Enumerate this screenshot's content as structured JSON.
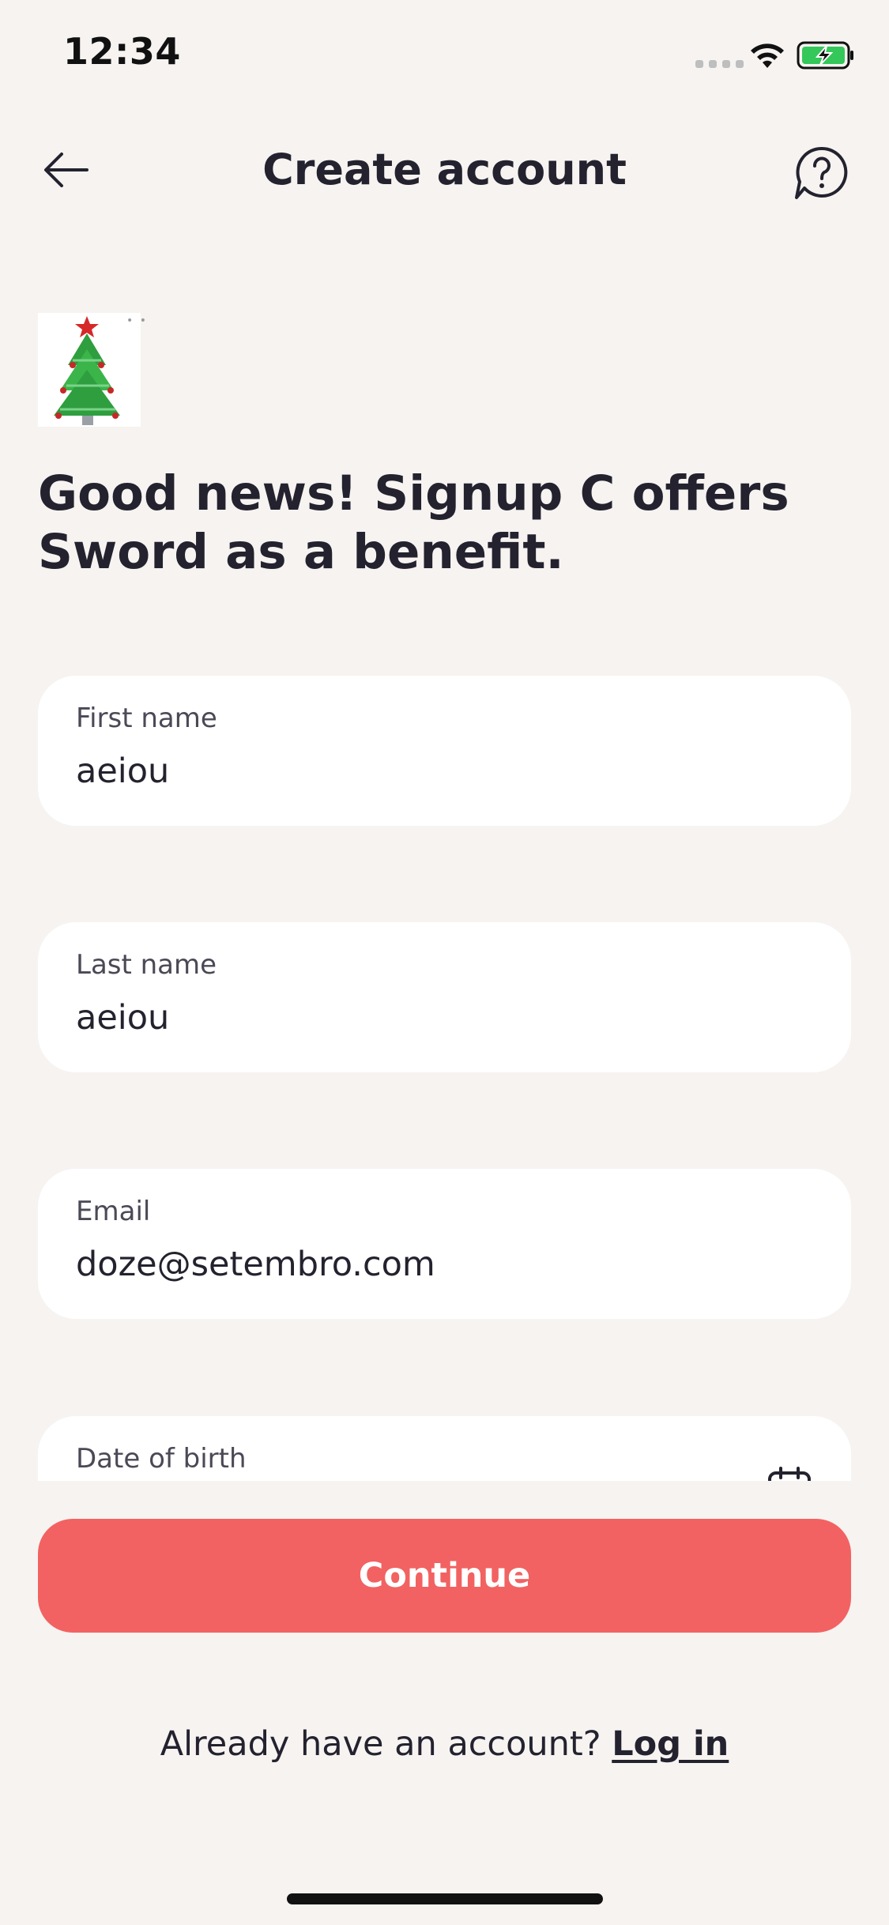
{
  "status_bar": {
    "time": "12:34"
  },
  "header": {
    "title": "Create account"
  },
  "headline": "Good news! Signup C offers Sword as a benefit.",
  "form": {
    "first_name": {
      "label": "First name",
      "value": "aeiou"
    },
    "last_name": {
      "label": "Last name",
      "value": "aeiou"
    },
    "email": {
      "label": "Email",
      "value": "doze@setembro.com"
    },
    "date_of_birth": {
      "label": "Date of birth",
      "value": ""
    }
  },
  "continue_label": "Continue",
  "login_prompt": {
    "text": "Already have an account?",
    "link": "Log in"
  },
  "colors": {
    "background": "#F6F3F1",
    "accent": "#F26262",
    "text": "#23222E",
    "battery": "#34C759"
  },
  "icons": {
    "back": "arrow-left-icon",
    "help": "help-chat-icon",
    "calendar": "calendar-icon",
    "logo": "christmas-tree-logo"
  }
}
